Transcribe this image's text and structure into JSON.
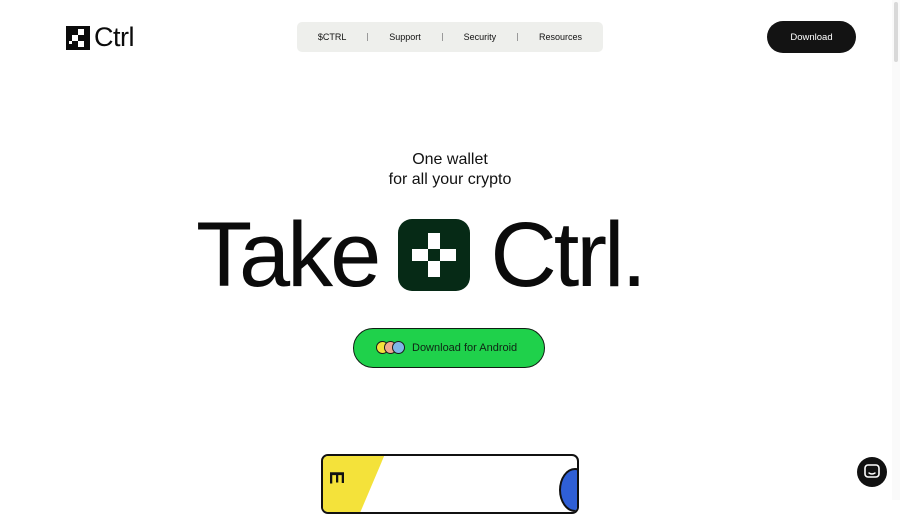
{
  "header": {
    "logo_text": "Ctrl",
    "nav": [
      "$CTRL",
      "Support",
      "Security",
      "Resources"
    ],
    "download_label": "Download"
  },
  "hero": {
    "subtitle_line1": "One wallet",
    "subtitle_line2": "for all your crypto",
    "headline_left": "Take",
    "headline_right": "Ctrl.",
    "cta_label": "Download for Android"
  },
  "card": {
    "visible_glyph": "E"
  },
  "colors": {
    "accent_green": "#1fd14b",
    "icon_dark_green": "#062a16",
    "dark": "#131313",
    "nav_bg": "#eeefec",
    "card_yellow": "#f4e23a",
    "card_blue": "#2f5fd6",
    "dot_colors": [
      "#f4e23a",
      "#f0a98f",
      "#7fb6e8"
    ]
  },
  "icons": [
    "ctrl-logo-icon",
    "ctrl-app-icon",
    "browser-dots-icon",
    "chat-icon"
  ]
}
